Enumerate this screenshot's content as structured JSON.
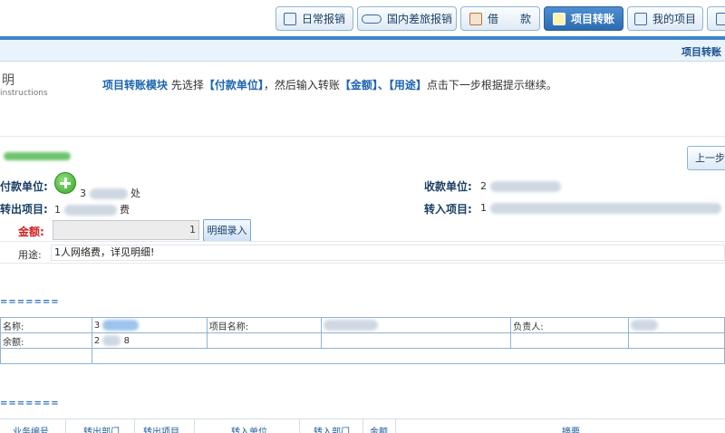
{
  "tabs": [
    {
      "label": "日常报销",
      "icon": "document-icon",
      "active": false
    },
    {
      "label": "国内差旅报销",
      "icon": "train-icon",
      "active": false
    },
    {
      "label": "借　　款",
      "icon": "loan-icon",
      "active": false
    },
    {
      "label": "项目转账",
      "icon": "transfer-icon",
      "active": true
    },
    {
      "label": "我的项目",
      "icon": "list-icon",
      "active": false
    }
  ],
  "breadcrumb": "项目转账",
  "instructions": {
    "title": "明",
    "subtitle": "instructions",
    "module_name": "项目转账模块",
    "text_1": " 先选择",
    "hl_1": "【付款单位】",
    "text_2": "，然后输入转账",
    "hl_2": "【金额】、【用途】",
    "text_3": "点击下一步根据提示继续。"
  },
  "buttons": {
    "prev_label": "上一步",
    "detail_label": "明细录入"
  },
  "form": {
    "payer_label": "付款单位:",
    "payer_value_prefix": "3",
    "payer_value_suffix": "处",
    "out_project_label": "转出项目:",
    "out_project_prefix": "1",
    "out_project_suffix": "费",
    "amount_label": "金额:",
    "amount_value": "1",
    "payee_label": "收款单位:",
    "payee_value_prefix": "2",
    "in_project_label": "转入项目:",
    "in_project_prefix": "1",
    "purpose_label": "用途:",
    "purpose_value": "1人网络费，详见明细!"
  },
  "divider_text": "=======",
  "info_table": {
    "name_label": "名称:",
    "name_value": "3",
    "project_name_label": "项目名称:",
    "owner_label": "负责人:",
    "balance_label": "余额:",
    "balance_value": "2",
    "balance_suffix": "8"
  },
  "list_headers": [
    "业务编号",
    "转出部门",
    "转出项目",
    "转入单位",
    "转入部门",
    "金额",
    "摘要"
  ]
}
